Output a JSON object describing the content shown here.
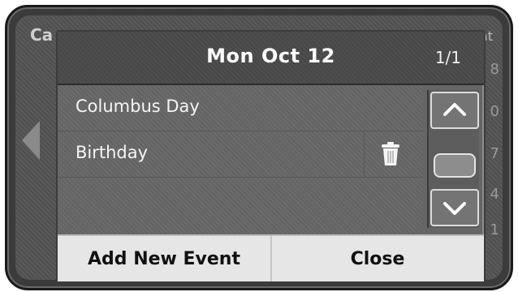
{
  "background": {
    "calendar_title": "Ca",
    "weekday": "at",
    "side_numbers": [
      "8",
      "0",
      "7",
      "4",
      "1"
    ]
  },
  "dialog": {
    "title": "Mon Oct 12",
    "page_indicator": "1/1",
    "events": [
      {
        "label": "Columbus Day",
        "deletable": false
      },
      {
        "label": "Birthday",
        "deletable": true,
        "delete_icon": "trash-icon"
      }
    ],
    "scroll": {
      "up_icon": "chevron-up-icon",
      "down_icon": "chevron-down-icon"
    },
    "footer": {
      "add_label": "Add New Event",
      "close_label": "Close"
    }
  }
}
